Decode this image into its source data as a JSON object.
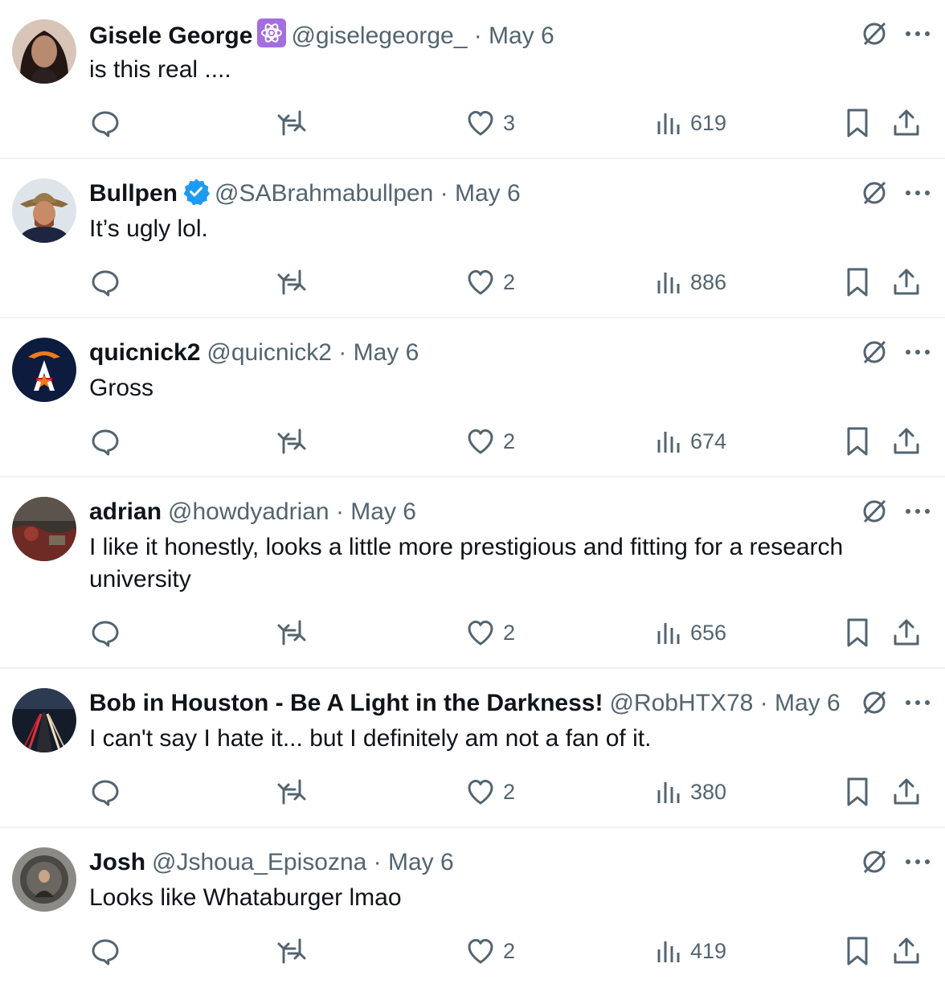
{
  "posts": [
    {
      "name": "Gisele George",
      "handle": "@giselegeorge_",
      "date": "May 6",
      "text": "is this real ....",
      "replies": "",
      "reposts": "",
      "likes": "3",
      "views": "619",
      "badge": "atom-badge",
      "avatar": "avatar-woman"
    },
    {
      "name": "Bullpen",
      "handle": "@SABrahmabullpen",
      "date": "May 6",
      "text": "It’s ugly lol.",
      "replies": "",
      "reposts": "",
      "likes": "2",
      "views": "886",
      "badge": "verified-badge",
      "avatar": "avatar-cowboy"
    },
    {
      "name": "quicnick2",
      "handle": "@quicnick2",
      "date": "May 6",
      "text": "Gross",
      "replies": "",
      "reposts": "",
      "likes": "2",
      "views": "674",
      "badge": "",
      "avatar": "avatar-logo"
    },
    {
      "name": "adrian",
      "handle": "@howdyadrian",
      "date": "May 6",
      "text": "I like it honestly, looks a little more prestigious and fitting for a research university",
      "replies": "",
      "reposts": "",
      "likes": "2",
      "views": "656",
      "badge": "",
      "avatar": "avatar-scene"
    },
    {
      "name": "Bob in Houston - Be A Light in the Darkness!",
      "handle": "@RobHTX78",
      "date": "May 6",
      "text": "I can't say I hate it... but I definitely am not a fan of it.",
      "replies": "",
      "reposts": "",
      "likes": "2",
      "views": "380",
      "badge": "",
      "avatar": "avatar-highway"
    },
    {
      "name": "Josh",
      "handle": "@Jshoua_Episozna",
      "date": "May 6",
      "text": "Looks like Whataburger lmao",
      "replies": "",
      "reposts": "",
      "likes": "2",
      "views": "419",
      "badge": "",
      "avatar": "avatar-elevator"
    }
  ],
  "separator": " · ",
  "colors": {
    "text": "#0f1419",
    "secondary": "#536471",
    "verified": "#1d9bf0",
    "divider": "#eff3f4",
    "atom_badge": "#a36ee0"
  }
}
